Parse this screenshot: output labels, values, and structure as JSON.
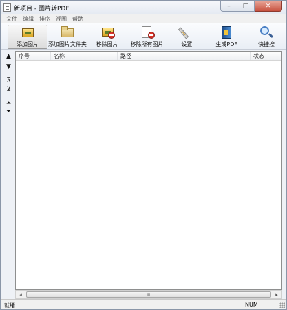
{
  "window": {
    "title": "新项目 - 图片转PDF",
    "controls": {
      "minimize": "–",
      "maximize": "□",
      "close": "✕"
    }
  },
  "menu": [
    "文件",
    "编辑",
    "排序",
    "视图",
    "帮助"
  ],
  "toolbar": [
    {
      "label": "添加图片",
      "icon": "add-image-icon"
    },
    {
      "label": "添加图片文件夹",
      "icon": "add-folder-icon"
    },
    {
      "label": "移除图片",
      "icon": "remove-image-icon"
    },
    {
      "label": "移除所有图片",
      "icon": "remove-all-images-icon"
    },
    {
      "label": "设置",
      "icon": "settings-icon"
    },
    {
      "label": "生成PDF",
      "icon": "generate-pdf-icon"
    },
    {
      "label": "快捷搜",
      "icon": "quick-search-icon"
    }
  ],
  "side_buttons": [
    "▲",
    "▼",
    "⊼",
    "⊻",
    "⏶",
    "⏷"
  ],
  "list": {
    "columns": [
      "序号",
      "名称",
      "路径",
      "状态"
    ]
  },
  "scrollbar": {
    "grip": "≡"
  },
  "status": {
    "text": "就绪",
    "num": "NUM"
  }
}
